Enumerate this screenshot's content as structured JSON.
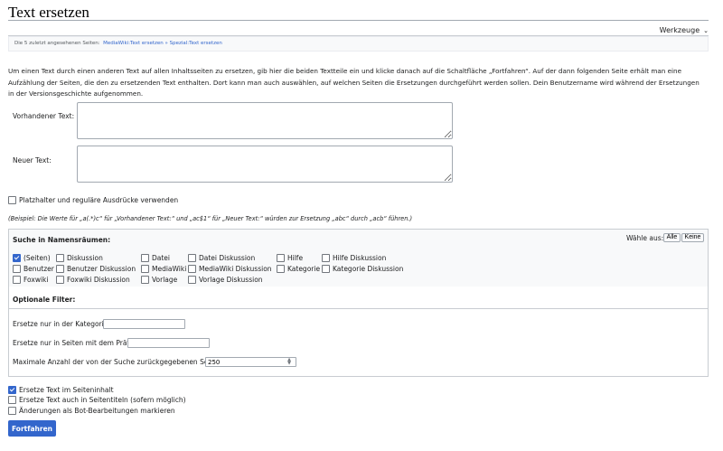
{
  "page_title": "Text ersetzen",
  "tools_label": "Werkzeuge",
  "recent": {
    "label": "Die 5 zuletzt angesehenen Seiten:",
    "link1": "MediaWiki:Text ersetzen",
    "separator": "»",
    "link2": "Spezial:Text ersetzen"
  },
  "intro": "Um einen Text durch einen anderen Text auf allen Inhaltsseiten zu ersetzen, gib hier die beiden Textteile ein und klicke danach auf die Schaltfläche „Fortfahren“. Auf der dann folgenden Seite erhält man eine Aufzählung der Seiten, die den zu ersetzenden Text enthalten. Dort kann man auch auswählen, auf welchen Seiten die Ersetzungen durchgeführt werden sollen. Dein Benutzername wird während der Ersetzungen in der Versionsgeschichte aufgenommen.",
  "form": {
    "existing_label": "Vorhandener Text:",
    "existing_value": "",
    "new_label": "Neuer Text:",
    "new_value": "",
    "regex_label": "Platzhalter und reguläre Ausdrücke verwenden",
    "example": "(Beispiel: Die Werte für „a(.*)c“ für „Vorhandener Text:“ und „ac$1“ für „Neuer Text:“ würden zur Ersetzung „abc“ durch „acb“ führen.)"
  },
  "namespaces": {
    "heading": "Suche in Namensräumen:",
    "choose_label": "Wähle aus:",
    "all_button": "Alle",
    "none_button": "Keine",
    "items": [
      {
        "label": "(Seiten)",
        "checked": true
      },
      {
        "label": "Diskussion",
        "checked": false
      },
      {
        "label": "Datei",
        "checked": false
      },
      {
        "label": "Datei Diskussion",
        "checked": false
      },
      {
        "label": "Hilfe",
        "checked": false
      },
      {
        "label": "Hilfe Diskussion",
        "checked": false
      },
      {
        "label": "Benutzer",
        "checked": false
      },
      {
        "label": "Benutzer Diskussion",
        "checked": false
      },
      {
        "label": "MediaWiki",
        "checked": false
      },
      {
        "label": "MediaWiki Diskussion",
        "checked": false
      },
      {
        "label": "Kategorie",
        "checked": false
      },
      {
        "label": "Kategorie Diskussion",
        "checked": false
      },
      {
        "label": "Foxwiki",
        "checked": false
      },
      {
        "label": "Foxwiki Diskussion",
        "checked": false
      },
      {
        "label": "Vorlage",
        "checked": false
      },
      {
        "label": "Vorlage Diskussion",
        "checked": false
      }
    ]
  },
  "filters": {
    "heading": "Optionale Filter:",
    "category_label": "Ersetze nur in der Kategorie:",
    "category_value": "",
    "prefix_label": "Ersetze nur in Seiten mit dem Präfix:",
    "prefix_value": "",
    "limit_label": "Maximale Anzahl der von der Suche zurückgegebenen Seiten:",
    "limit_value": "250"
  },
  "options": {
    "content_label": "Ersetze Text im Seiteninhalt",
    "content_checked": true,
    "titles_label": "Ersetze Text auch in Seitentiteln (sofern möglich)",
    "titles_checked": false,
    "bot_label": "Änderungen als Bot-Bearbeitungen markieren",
    "bot_checked": false
  },
  "submit_label": "Fortfahren"
}
